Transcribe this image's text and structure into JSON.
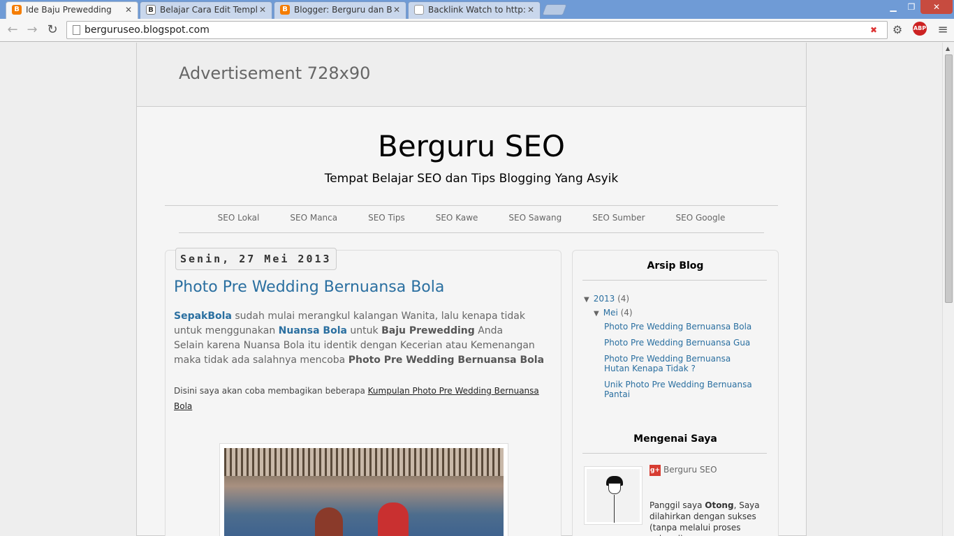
{
  "tabs": [
    {
      "title": "Ide Baju Prewedding",
      "icon": "blogger-icon",
      "active": true
    },
    {
      "title": "Belajar Cara Edit Template",
      "icon": "b-icon",
      "active": false
    },
    {
      "title": "Blogger: Berguru dan Bela",
      "icon": "blogger-icon",
      "active": false
    },
    {
      "title": "Backlink Watch to http://v",
      "icon": "page-icon",
      "active": false
    }
  ],
  "address": {
    "url": "berguruseo.blogspot.com"
  },
  "extensions": {
    "abp": "ABP"
  },
  "ad": {
    "text": "Advertisement 728x90"
  },
  "header": {
    "title": "Berguru SEO",
    "description": "Tempat Belajar SEO dan Tips Blogging Yang Asyik"
  },
  "nav": [
    "SEO Lokal",
    "SEO Manca",
    "SEO Tips",
    "SEO Kawe",
    "SEO Sawang",
    "SEO Sumber",
    "SEO Google"
  ],
  "post": {
    "date": "Senin, 27 Mei 2013",
    "title": "Photo Pre Wedding Bernuansa Bola",
    "p1_link1": "SepakBola",
    "p1_t1": " sudah mulai merangkul kalangan Wanita, lalu kenapa tidak untuk menggunakan ",
    "p1_link2": "Nuansa Bola",
    "p1_t2": " untuk ",
    "p1_bold1": "Baju Prewedding",
    "p1_t3": " Anda",
    "p2_t1": "Selain karena Nuansa Bola itu identik dengan Kecerian atau Kemenangan maka tidak ada salahnya mencoba ",
    "p2_bold": "Photo Pre Wedding Bernuansa Bola",
    "p3_t1": "Disini saya akan coba membagikan beberapa ",
    "p3_link": "Kumpulan Photo Pre Wedding Bernuansa Bola"
  },
  "sidebar": {
    "archive_title": "Arsip Blog",
    "year": "2013",
    "year_count": "(4)",
    "month": "Mei",
    "month_count": "(4)",
    "posts": [
      "Photo Pre Wedding Bernuansa Bola",
      "Photo Pre Wedding Bernuansa Gua",
      "Photo Pre Wedding Bernuansa Hutan Kenapa Tidak ?",
      "Unik Photo Pre Wedding Bernuansa Pantai"
    ],
    "about_title": "Mengenai Saya",
    "author": "Berguru SEO",
    "about_t1": "Panggil saya ",
    "about_name": "Otong",
    "about_t2": ", Saya dilahirkan dengan sukses (tanpa melalui proses suksesi)"
  }
}
